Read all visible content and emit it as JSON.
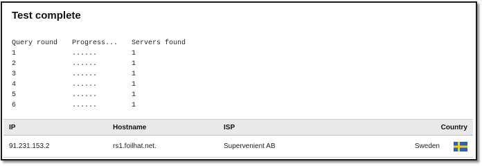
{
  "title": "Test complete",
  "query_table": {
    "headers": [
      "Query round",
      "Progress...",
      "Servers found"
    ],
    "rows": [
      {
        "round": "1",
        "progress": "......",
        "servers": "1"
      },
      {
        "round": "2",
        "progress": "......",
        "servers": "1"
      },
      {
        "round": "3",
        "progress": "......",
        "servers": "1"
      },
      {
        "round": "4",
        "progress": "......",
        "servers": "1"
      },
      {
        "round": "5",
        "progress": "......",
        "servers": "1"
      },
      {
        "round": "6",
        "progress": "......",
        "servers": "1"
      }
    ]
  },
  "results_table": {
    "headers": {
      "ip": "IP",
      "hostname": "Hostname",
      "isp": "ISP",
      "country": "Country"
    },
    "rows": [
      {
        "ip": "91.231.153.2",
        "hostname": "rs1.foilhat.net.",
        "isp": "Supervenient AB",
        "country": "Sweden",
        "flag_icon": "sweden-flag-icon"
      }
    ]
  },
  "colors": {
    "header_bg": "#e9e9e9",
    "flag_blue": "#2a62b8",
    "flag_yellow": "#f5cf1b"
  }
}
